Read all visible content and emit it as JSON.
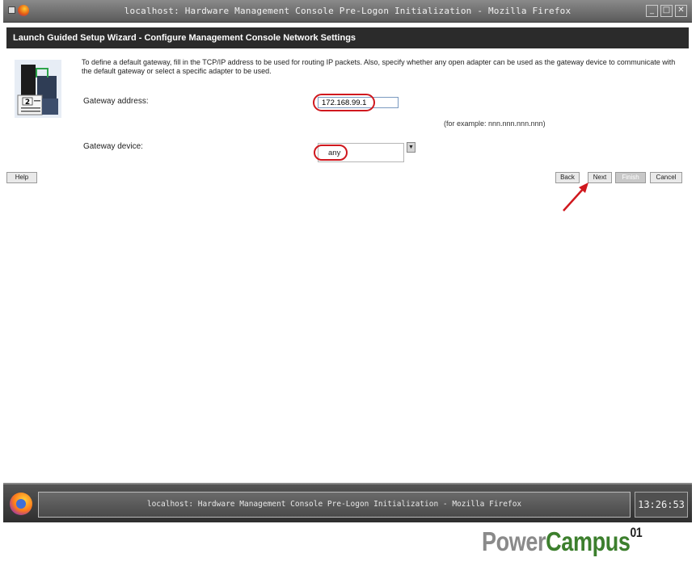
{
  "window": {
    "title": "localhost: Hardware Management Console Pre-Logon Initialization - Mozilla Firefox"
  },
  "wizard": {
    "header": "Launch Guided Setup Wizard - Configure Management Console Network Settings",
    "description": "To define a default gateway, fill in the TCP/IP address to be used for routing IP packets. Also, specify whether any open adapter can be used as the gateway device to communicate with the default gateway or select a specific adapter to be used.",
    "icon_step_number": "2",
    "gateway_address_label": "Gateway address:",
    "gateway_address_value": "172.168.99.1",
    "example_text": "(for example: nnn.nnn.nnn.nnn)",
    "gateway_device_label": "Gateway device:",
    "gateway_device_value": "any"
  },
  "buttons": {
    "help": "Help",
    "back": "Back",
    "next": "Next",
    "finish": "Finish",
    "cancel": "Cancel"
  },
  "taskbar": {
    "task_title": "localhost: Hardware Management Console Pre-Logon Initialization - Mozilla Firefox",
    "clock": "13:26:53"
  },
  "watermark": {
    "brand_part1": "Power",
    "brand_part2": "Campus",
    "brand_suffix": "01"
  },
  "colors": {
    "highlight_ring": "#d0181e",
    "header_bg": "#2b2b2b",
    "brand_green": "#3c7f2d"
  }
}
